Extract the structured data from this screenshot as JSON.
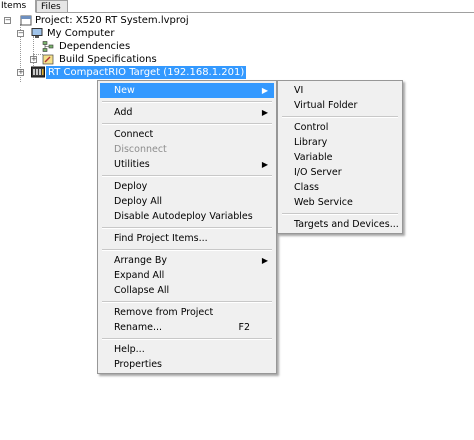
{
  "tabs": [
    {
      "label": "Items"
    },
    {
      "label": "Files"
    }
  ],
  "tree": {
    "project": "Project: X520 RT System.lvproj",
    "my_computer": "My Computer",
    "dependencies": "Dependencies",
    "build_specifications": "Build Specifications",
    "target": "RT CompactRIO Target (192.168.1.201)",
    "target_visible": "RT CompactRIO Target (192.168.1.201)"
  },
  "context_menu": {
    "new": "New",
    "add": "Add",
    "connect": "Connect",
    "disconnect": "Disconnect",
    "utilities": "Utilities",
    "deploy": "Deploy",
    "deploy_all": "Deploy All",
    "disable_autodeploy": "Disable Autodeploy Variables",
    "find_project_items": "Find Project Items...",
    "arrange_by": "Arrange By",
    "expand_all": "Expand All",
    "collapse_all": "Collapse All",
    "remove_from_project": "Remove from Project",
    "rename": "Rename...",
    "rename_shortcut": "F2",
    "help": "Help...",
    "properties": "Properties"
  },
  "new_submenu": {
    "vi": "VI",
    "virtual_folder": "Virtual Folder",
    "control": "Control",
    "library": "Library",
    "variable": "Variable",
    "io_server": "I/O Server",
    "class": "Class",
    "web_service": "Web Service",
    "targets_and_devices": "Targets and Devices..."
  },
  "colors": {
    "highlight": "#3399ff",
    "menu_bg": "#f0f0f0"
  }
}
